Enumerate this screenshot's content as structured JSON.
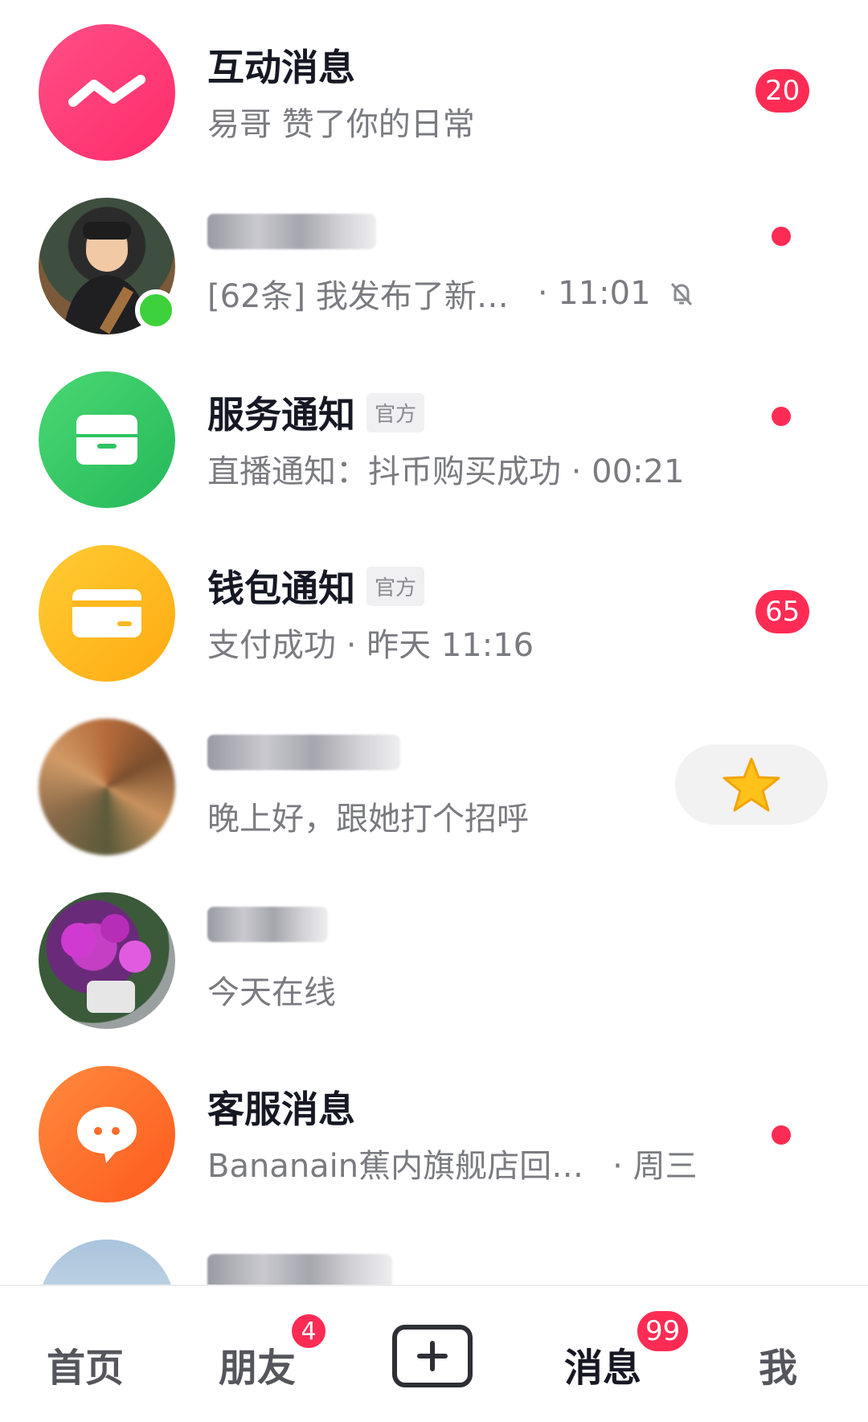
{
  "conversations": [
    {
      "title": "互动消息",
      "subtitle": "易哥 赞了你的日常",
      "badge": "20"
    },
    {
      "title": "",
      "subtitle": "[62条] 我发布了新…",
      "time": "· 11:01",
      "muted": true,
      "dot": true
    },
    {
      "title": "服务通知",
      "tag": "官方",
      "subtitle": "直播通知：抖币购买成功 · 00:21",
      "dot": true
    },
    {
      "title": "钱包通知",
      "tag": "官方",
      "subtitle": "支付成功 · 昨天 11:16",
      "badge": "65"
    },
    {
      "title": "",
      "subtitle": "晚上好，跟她打个招呼",
      "action_icon": "star-icon"
    },
    {
      "title": "",
      "subtitle": "今天在线"
    },
    {
      "title": "客服消息",
      "subtitle": "Bananain蕉内旗舰店回…",
      "time": "· 周三",
      "dot": true
    }
  ],
  "tabbar": {
    "home": "首页",
    "friends": "朋友",
    "friends_badge": "4",
    "messages": "消息",
    "messages_badge": "99",
    "me": "我"
  },
  "colors": {
    "accent": "#fe2c55",
    "online": "#3dd23b",
    "service": "#2ec462",
    "wallet": "#ffb81f",
    "support": "#fe6b2a",
    "interactive": "#fe3f7b"
  }
}
